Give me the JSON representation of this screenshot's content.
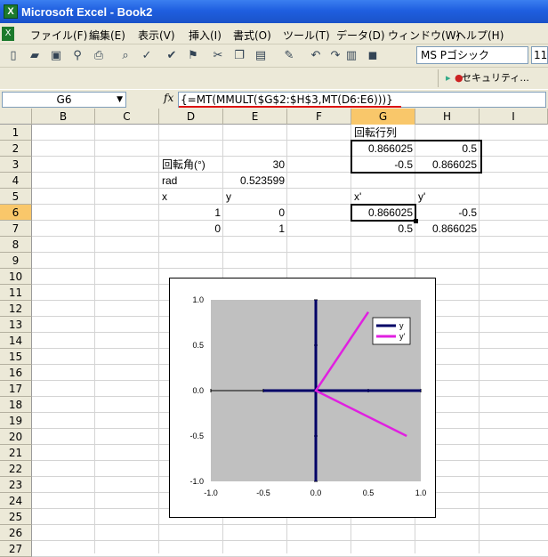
{
  "window": {
    "title": "Microsoft Excel - Book2",
    "app_icon": "excel-icon"
  },
  "menu": [
    "ファイル(F)",
    "編集(E)",
    "表示(V)",
    "挿入(I)",
    "書式(O)",
    "ツール(T)",
    "データ(D)",
    "ウィンドウ(W)",
    "ヘルプ(H)"
  ],
  "toolbar": {
    "icons": [
      "new-icon",
      "open-icon",
      "save-icon",
      "permission-icon",
      "print-icon",
      "print-preview-icon",
      "spelling-icon",
      "research-icon",
      "cut-icon",
      "copy-icon",
      "paste-icon",
      "format-painter-icon",
      "undo-icon",
      "redo-icon",
      "chart-icon",
      "help-icon"
    ],
    "font": "MS Pゴシック",
    "size": "11"
  },
  "security": {
    "label": "セキュリティ..."
  },
  "namebox": "G6",
  "fx": "fx",
  "formula": "{=MT(MMULT($G$2:$H$3,MT(D6:E6)))}",
  "columns": [
    "B",
    "C",
    "D",
    "E",
    "F",
    "G",
    "H",
    "I"
  ],
  "rows": [
    "1",
    "2",
    "3",
    "4",
    "5",
    "6",
    "7",
    "8",
    "9",
    "10",
    "11",
    "12",
    "13",
    "14",
    "15",
    "16",
    "17",
    "18",
    "19",
    "20",
    "21",
    "22",
    "23",
    "24",
    "25",
    "26",
    "27"
  ],
  "cells": {
    "G1": "回転行列",
    "G2": "0.866025",
    "H2": "0.5",
    "D3": "回転角(°)",
    "E3": "30",
    "G3": "-0.5",
    "H3": "0.866025",
    "D4": "rad",
    "E4": "0.523599",
    "D5": "x",
    "E5": "y",
    "G5": "x'",
    "H5": "y'",
    "E6": "0",
    "D6": "1",
    "G6": "0.866025",
    "H6": "-0.5",
    "D7": "0",
    "E7": "1",
    "G7": "0.5",
    "H7": "0.866025"
  },
  "chart_data": {
    "type": "scatter",
    "xlim": [
      -1.0,
      1.0
    ],
    "ylim": [
      -1.0,
      1.0
    ],
    "x_ticks": [
      "-1.0",
      "-0.5",
      "0.0",
      "0.5",
      "1.0"
    ],
    "y_ticks": [
      "1.0",
      "0.5",
      "0.0",
      "-0.5",
      "-1.0"
    ],
    "legend_position": "top-right",
    "series": [
      {
        "name": "y",
        "color": "#000066",
        "x": [
          -0.5,
          1.0
        ],
        "y": [
          0,
          0
        ]
      },
      {
        "name": "y",
        "color": "#000066",
        "x": [
          0,
          0
        ],
        "y": [
          -1.0,
          1.0
        ]
      },
      {
        "name": "y'",
        "color": "#e020e0",
        "x": [
          0.866025,
          0,
          0.5
        ],
        "y": [
          -0.5,
          0,
          0.866025
        ]
      }
    ],
    "legend": [
      {
        "name": "y",
        "color": "#000066"
      },
      {
        "name": "y'",
        "color": "#e020e0"
      }
    ]
  }
}
